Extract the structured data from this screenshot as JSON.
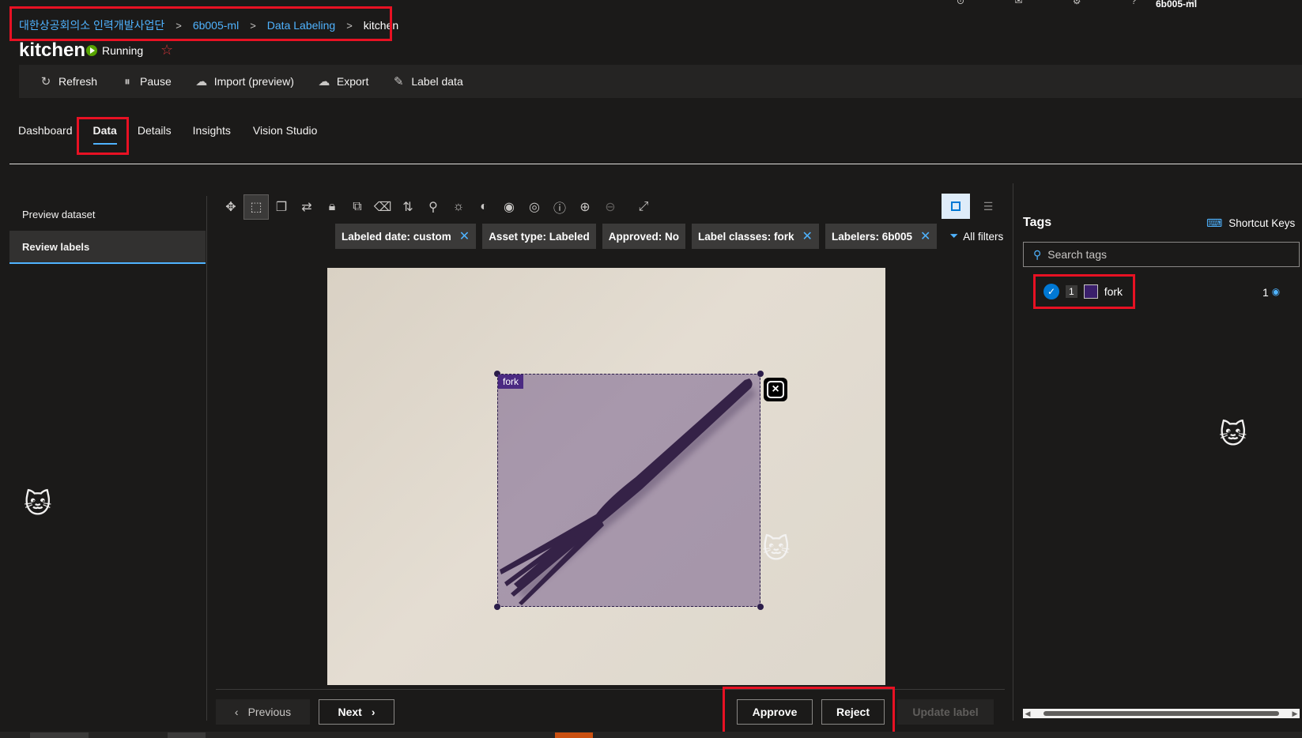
{
  "header": {
    "account": "6b005-ml",
    "breadcrumb": [
      "대한상공회의소 인력개발사업단",
      "6b005-ml",
      "Data Labeling",
      "kitchen"
    ],
    "title": "kitchen",
    "status": "Running"
  },
  "commands": [
    {
      "label": "Refresh",
      "icon": "refresh-icon"
    },
    {
      "label": "Pause",
      "icon": "pause-icon"
    },
    {
      "label": "Import (preview)",
      "icon": "cloud-upload-icon"
    },
    {
      "label": "Export",
      "icon": "cloud-download-icon"
    },
    {
      "label": "Label data",
      "icon": "edit-icon"
    }
  ],
  "tabs": [
    "Dashboard",
    "Data",
    "Details",
    "Insights",
    "Vision Studio"
  ],
  "active_tab": "Data",
  "leftnav": [
    "Preview dataset",
    "Review labels"
  ],
  "filters": [
    {
      "label": "Labeled date: custom",
      "removable": true
    },
    {
      "label": "Asset type: Labeled",
      "removable": false
    },
    {
      "label": "Approved: No",
      "removable": false
    },
    {
      "label": "Label classes: fork",
      "removable": true
    },
    {
      "label": "Labelers: 6b005",
      "removable": true
    }
  ],
  "all_filters": "All filters",
  "annotation": {
    "label": "fork",
    "color": "#4b2a82"
  },
  "navigation": {
    "previous": "Previous",
    "next": "Next"
  },
  "actions": {
    "approve": "Approve",
    "reject": "Reject",
    "update": "Update label"
  },
  "tags_panel": {
    "title": "Tags",
    "shortcut_keys": "Shortcut Keys",
    "search_placeholder": "Search tags",
    "tags": [
      {
        "index": "1",
        "name": "fork",
        "count": "1",
        "color": "#3a1f6b"
      }
    ]
  },
  "colors": {
    "accent": "#4fb3ff",
    "highlight": "#e81123",
    "background": "#1b1a19"
  }
}
